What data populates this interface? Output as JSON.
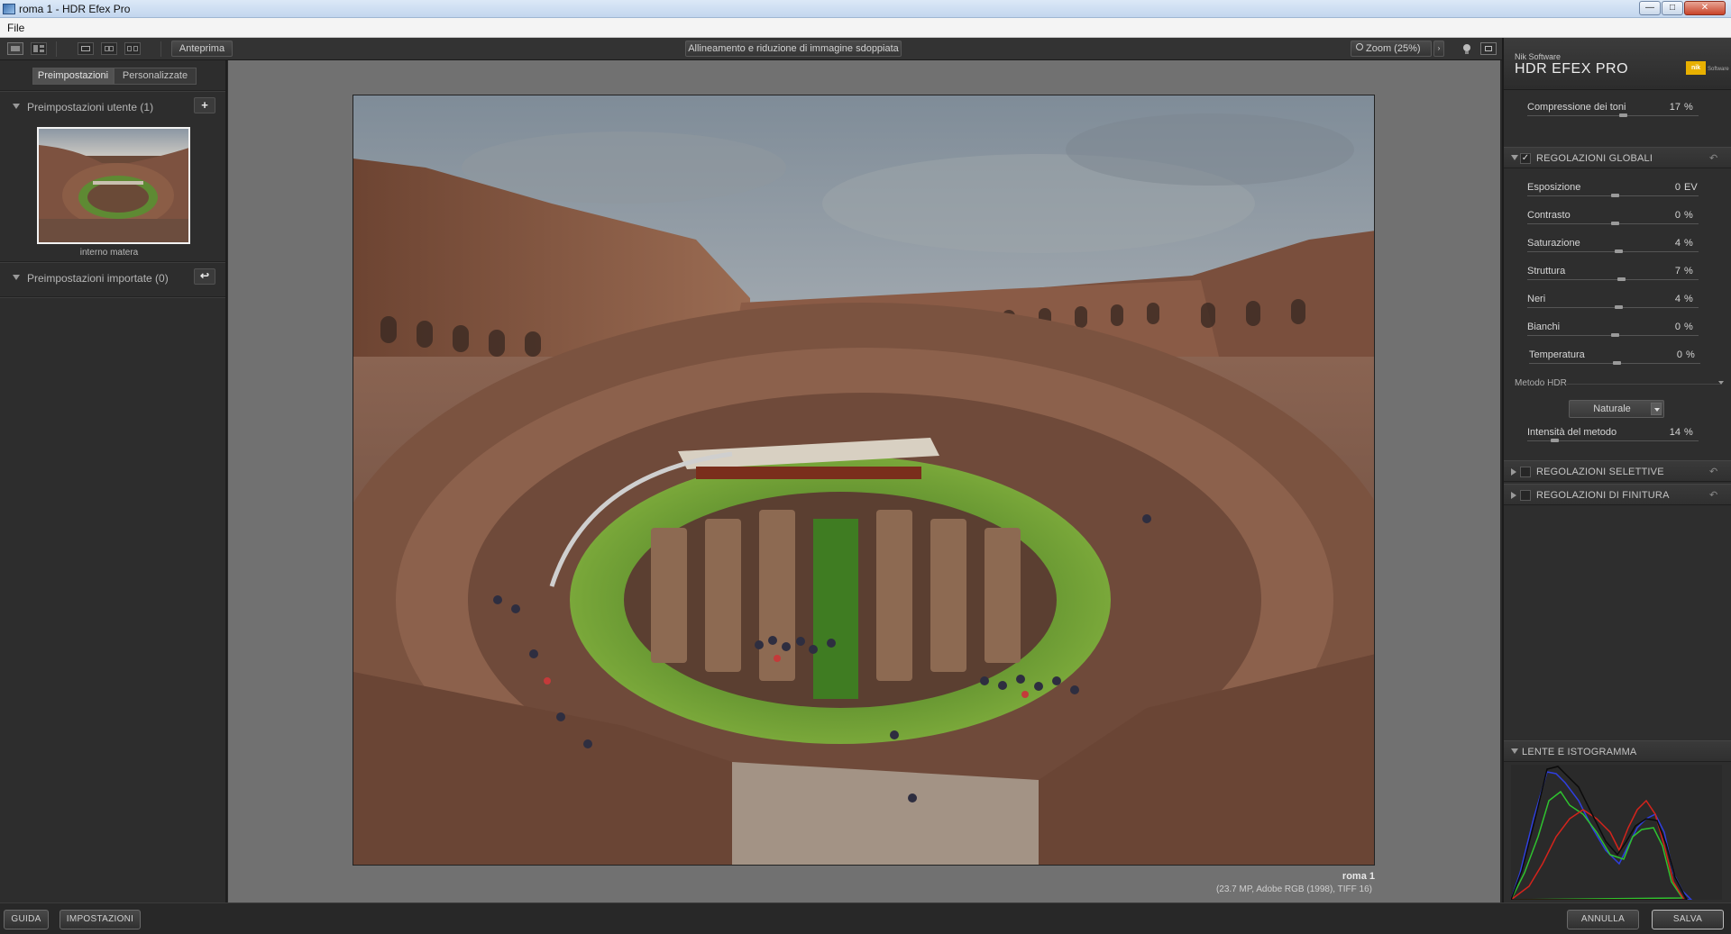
{
  "window": {
    "title": "roma 1 - HDR Efex Pro",
    "min_glyph": "—",
    "max_glyph": "□",
    "close_glyph": "✕"
  },
  "menu": {
    "file": "File"
  },
  "toolbar": {
    "preview_label": "Anteprima",
    "status_label": "Allineamento e riduzione di immagine sdoppiata",
    "zoom_label": "Zoom (25%)"
  },
  "left_panel": {
    "tabs": [
      {
        "label": "Preimpostazioni",
        "active": true
      },
      {
        "label": "Personalizzate",
        "active": false
      }
    ],
    "user_presets": {
      "title": "Preimpostazioni utente (1)",
      "add_glyph": "+"
    },
    "preset_items": [
      {
        "label": "interno matera"
      }
    ],
    "imported_presets": {
      "title": "Preimpostazioni importate (0)",
      "import_glyph": "↩"
    }
  },
  "image_info": {
    "name": "roma 1",
    "meta": "(23.7 MP, Adobe RGB (1998), TIFF 16)"
  },
  "right_panel": {
    "brand_small": "Nik Software",
    "brand_title": "HDR EFEX PRO",
    "brand_logo": "nik",
    "brand_logo_sub": "Software",
    "tone_compression": {
      "name": "Compressione dei toni",
      "value": "17",
      "unit": "%",
      "level": 0.55
    },
    "global_adjustments": {
      "title": "REGOLAZIONI GLOBALI",
      "enabled": true,
      "check_glyph": "✓",
      "reset_glyph": "↶",
      "sliders": [
        {
          "name": "Esposizione",
          "value": "0",
          "unit": "EV",
          "level": 0.5
        },
        {
          "name": "Contrasto",
          "value": "0",
          "unit": "%",
          "level": 0.5
        },
        {
          "name": "Saturazione",
          "value": "4",
          "unit": "%",
          "level": 0.52
        },
        {
          "name": "Struttura",
          "value": "7",
          "unit": "%",
          "level": 0.54
        },
        {
          "name": "Neri",
          "value": "4",
          "unit": "%",
          "level": 0.52
        },
        {
          "name": "Bianchi",
          "value": "0",
          "unit": "%",
          "level": 0.5
        },
        {
          "name": "Temperatura",
          "value": "0",
          "unit": "%",
          "level": 0.5
        }
      ]
    },
    "hdr_method": {
      "label": "Metodo HDR",
      "selected": "Naturale",
      "intensity": {
        "name": "Intensità del metodo",
        "value": "14",
        "unit": "%",
        "level": 0.14
      }
    },
    "selective": {
      "title": "REGOLAZIONI SELETTIVE",
      "enabled": false,
      "reset_glyph": "↶"
    },
    "finishing": {
      "title": "REGOLAZIONI DI FINITURA",
      "enabled": false,
      "reset_glyph": "↶"
    },
    "loupe": {
      "title": "LENTE E ISTOGRAMMA"
    }
  },
  "bottom": {
    "help": "GUIDA",
    "settings": "IMPOSTAZIONI",
    "cancel": "ANNULLA",
    "save": "SALVA"
  },
  "colors": {
    "panel": "#2d2d2d",
    "canvas": "#717171",
    "hist_red": "#d4241c",
    "hist_green": "#2fc22f",
    "hist_blue": "#2f3fe0",
    "hist_black": "#0b0b0b"
  }
}
